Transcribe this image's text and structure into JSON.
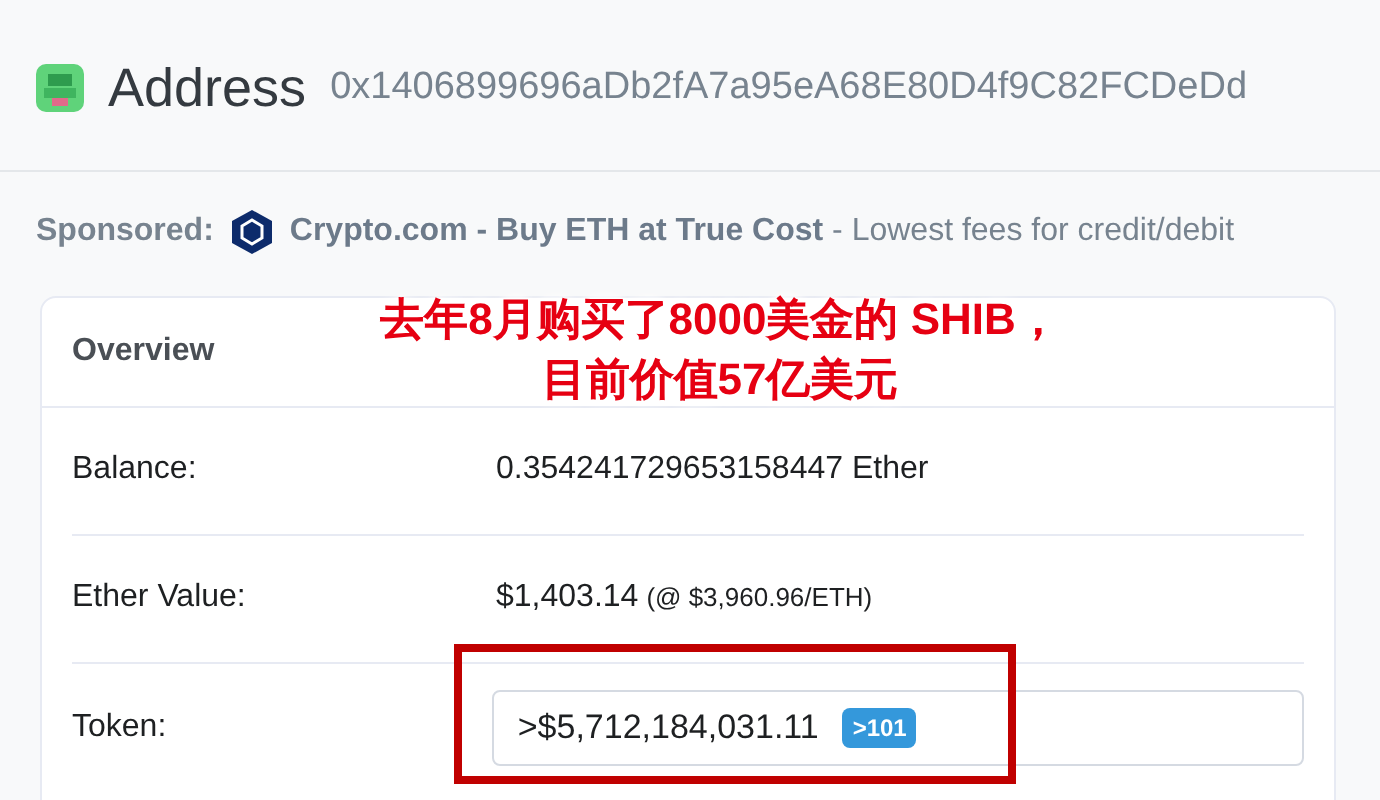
{
  "header": {
    "title": "Address",
    "address": "0x1406899696aDb2fA7a95eA68E80D4f9C82FCDeDd"
  },
  "sponsored": {
    "label": "Sponsored:",
    "headline": "Crypto.com - Buy ETH at True Cost",
    "tagline": " - Lowest fees for credit/debit"
  },
  "overview": {
    "title": "Overview",
    "rows": [
      {
        "kind": "text",
        "label": "Balance:",
        "value": "0.354241729653158447 Ether"
      },
      {
        "kind": "text",
        "label": "Ether Value:",
        "value": "$1,403.14",
        "note": "(@ $3,960.96/ETH)"
      },
      {
        "kind": "dropdown",
        "label": "Token:",
        "value": ">$5,712,184,031.11",
        "badge": ">101"
      }
    ]
  },
  "annotation": {
    "lines": [
      "去年8月购买了8000美金的 SHIB，",
      "目前价值57亿美元"
    ]
  }
}
